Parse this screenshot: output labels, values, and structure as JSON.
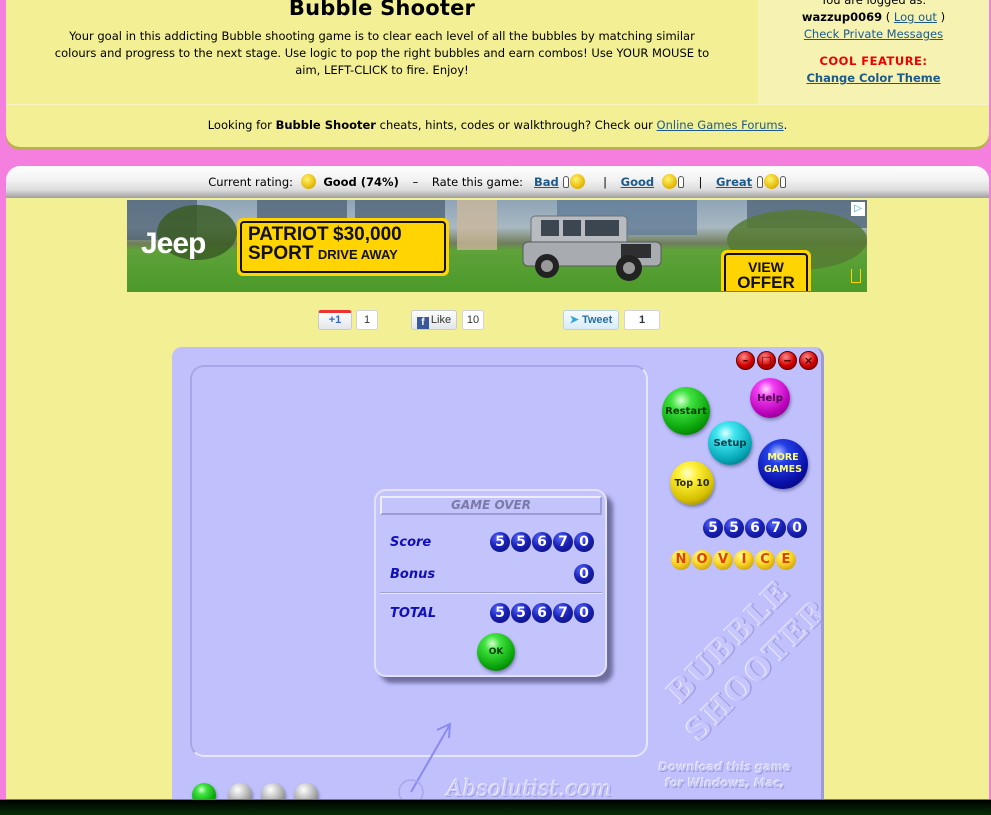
{
  "header": {
    "title": "Bubble Shooter",
    "description": "Your goal in this addicting Bubble shooting game is to clear each level of all the bubbles by matching similar colours and progress to the next stage. Use logic to pop the right bubbles and earn combos! Use YOUR MOUSE to aim, LEFT-CLICK to fire. Enjoy!"
  },
  "user_box": {
    "logged_in_label": "You are logged as:",
    "username": "wazzup0069",
    "logout_open": "(",
    "logout_label": "Log out",
    "logout_close": ")",
    "messages_link": "Check Private Messages",
    "cool_feature_label": "COOL FEATURE:",
    "theme_link": "Change Color Theme"
  },
  "forum_line": {
    "prefix": "Looking for",
    "game_name": "Bubble Shooter",
    "middle": "cheats, hints, codes or walkthrough? Check our",
    "link": "Online Games Forums",
    "suffix": "."
  },
  "rating": {
    "current_label": "Current rating:",
    "current_value": "Good (74%)",
    "dash": "–",
    "rate_label": "Rate this game:",
    "options": [
      {
        "label": "Bad",
        "icon": "thumbs-down-sad-smiley-icon"
      },
      {
        "label": "Good",
        "icon": "thumbs-up-cool-smiley-icon"
      },
      {
        "label": "Great",
        "icon": "two-thumbs-up-grin-smiley-icon"
      }
    ],
    "separator": "|"
  },
  "ad": {
    "brand": "Jeep",
    "line1_a": "PATRIOT",
    "line1_b": "$30,000",
    "line2_a": "SPORT",
    "line2_b": "DRIVE AWAY",
    "cta_1": "VIEW",
    "cta_2": "OFFER",
    "adchoices_icon": "▷",
    "colors": {
      "yellow": "#ffd400"
    }
  },
  "social": {
    "gplus_label": "+1",
    "gplus_count": "1",
    "fb_icon": "f",
    "fb_label": "Like",
    "fb_count": "10",
    "tweet_icon": "🐦",
    "tweet_label": "Tweet",
    "tweet_count": "1"
  },
  "game": {
    "window_controls": [
      "minimize",
      "maximize",
      "restore",
      "close"
    ],
    "buttons": {
      "restart": "Restart",
      "help": "Help",
      "setup": "Setup",
      "more_games": "MORE GAMES",
      "top10": "Top 10"
    },
    "score_digits": [
      "5",
      "5",
      "6",
      "7",
      "0"
    ],
    "level_letters": [
      "N",
      "O",
      "V",
      "I",
      "C",
      "E"
    ],
    "watermark": "BUBBLE SHOOTER",
    "download_text": "Download this game for Windows, Mac,",
    "site_mark": "Absolutist.com",
    "dialog": {
      "title": "GAME OVER",
      "score_label": "Score",
      "score_digits": [
        "5",
        "5",
        "6",
        "7",
        "0"
      ],
      "bonus_label": "Bonus",
      "bonus_digits": [
        "0"
      ],
      "total_label": "TOTAL",
      "total_digits": [
        "5",
        "5",
        "6",
        "7",
        "0"
      ],
      "ok_label": "OK"
    },
    "next_bubbles": [
      "green",
      "gray",
      "gray",
      "gray"
    ],
    "colors": {
      "panel": "#c0c0fc",
      "digit_blue": "#1a22b8",
      "letter_gold": "#ffd92a"
    }
  },
  "theme": {
    "page_bg": "#f57fde",
    "panel_bg": "#f2ef94",
    "link": "#1d5a8a",
    "cool_red": "#ee0000"
  }
}
